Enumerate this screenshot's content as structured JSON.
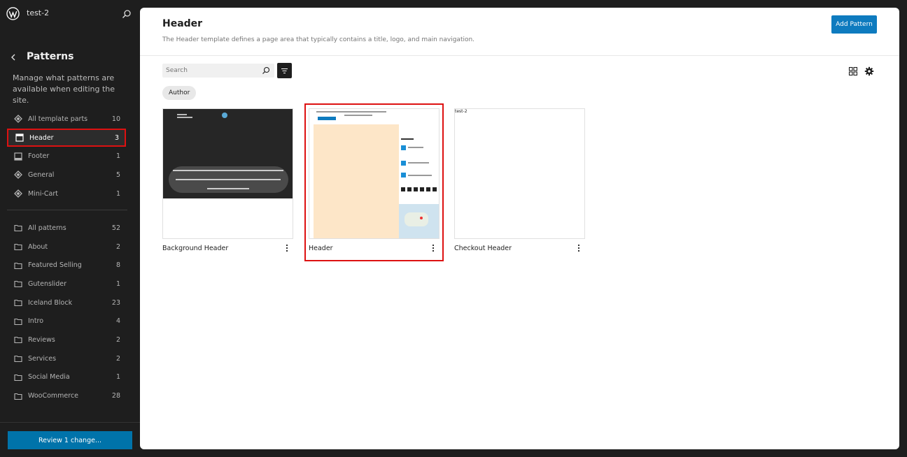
{
  "site": {
    "name": "test-2"
  },
  "sidebar": {
    "title": "Patterns",
    "description": "Manage what patterns are available when editing the site.",
    "template_parts": [
      {
        "label": "All template parts",
        "count": "10"
      },
      {
        "label": "Header",
        "count": "3"
      },
      {
        "label": "Footer",
        "count": "1"
      },
      {
        "label": "General",
        "count": "5"
      },
      {
        "label": "Mini-Cart",
        "count": "1"
      }
    ],
    "categories": [
      {
        "label": "All patterns",
        "count": "52"
      },
      {
        "label": "About",
        "count": "2"
      },
      {
        "label": "Featured Selling",
        "count": "8"
      },
      {
        "label": "Gutenslider",
        "count": "1"
      },
      {
        "label": "Iceland Block",
        "count": "23"
      },
      {
        "label": "Intro",
        "count": "4"
      },
      {
        "label": "Reviews",
        "count": "2"
      },
      {
        "label": "Services",
        "count": "2"
      },
      {
        "label": "Social Media",
        "count": "1"
      },
      {
        "label": "WooCommerce",
        "count": "28"
      }
    ],
    "review_button": "Review 1 change..."
  },
  "main": {
    "title": "Header",
    "description": "The Header template defines a page area that typically contains a title, logo, and main navigation.",
    "add_button": "Add Pattern",
    "search_placeholder": "Search",
    "author_chip": "Author",
    "cards": [
      {
        "title": "Background Header"
      },
      {
        "title": "Header"
      },
      {
        "title": "Checkout Header",
        "preview_label": "test-2"
      }
    ]
  },
  "colors": {
    "accent": "#0e7bbf",
    "highlight": "#dd1111",
    "sidebar_bg": "#1e1e1e"
  }
}
